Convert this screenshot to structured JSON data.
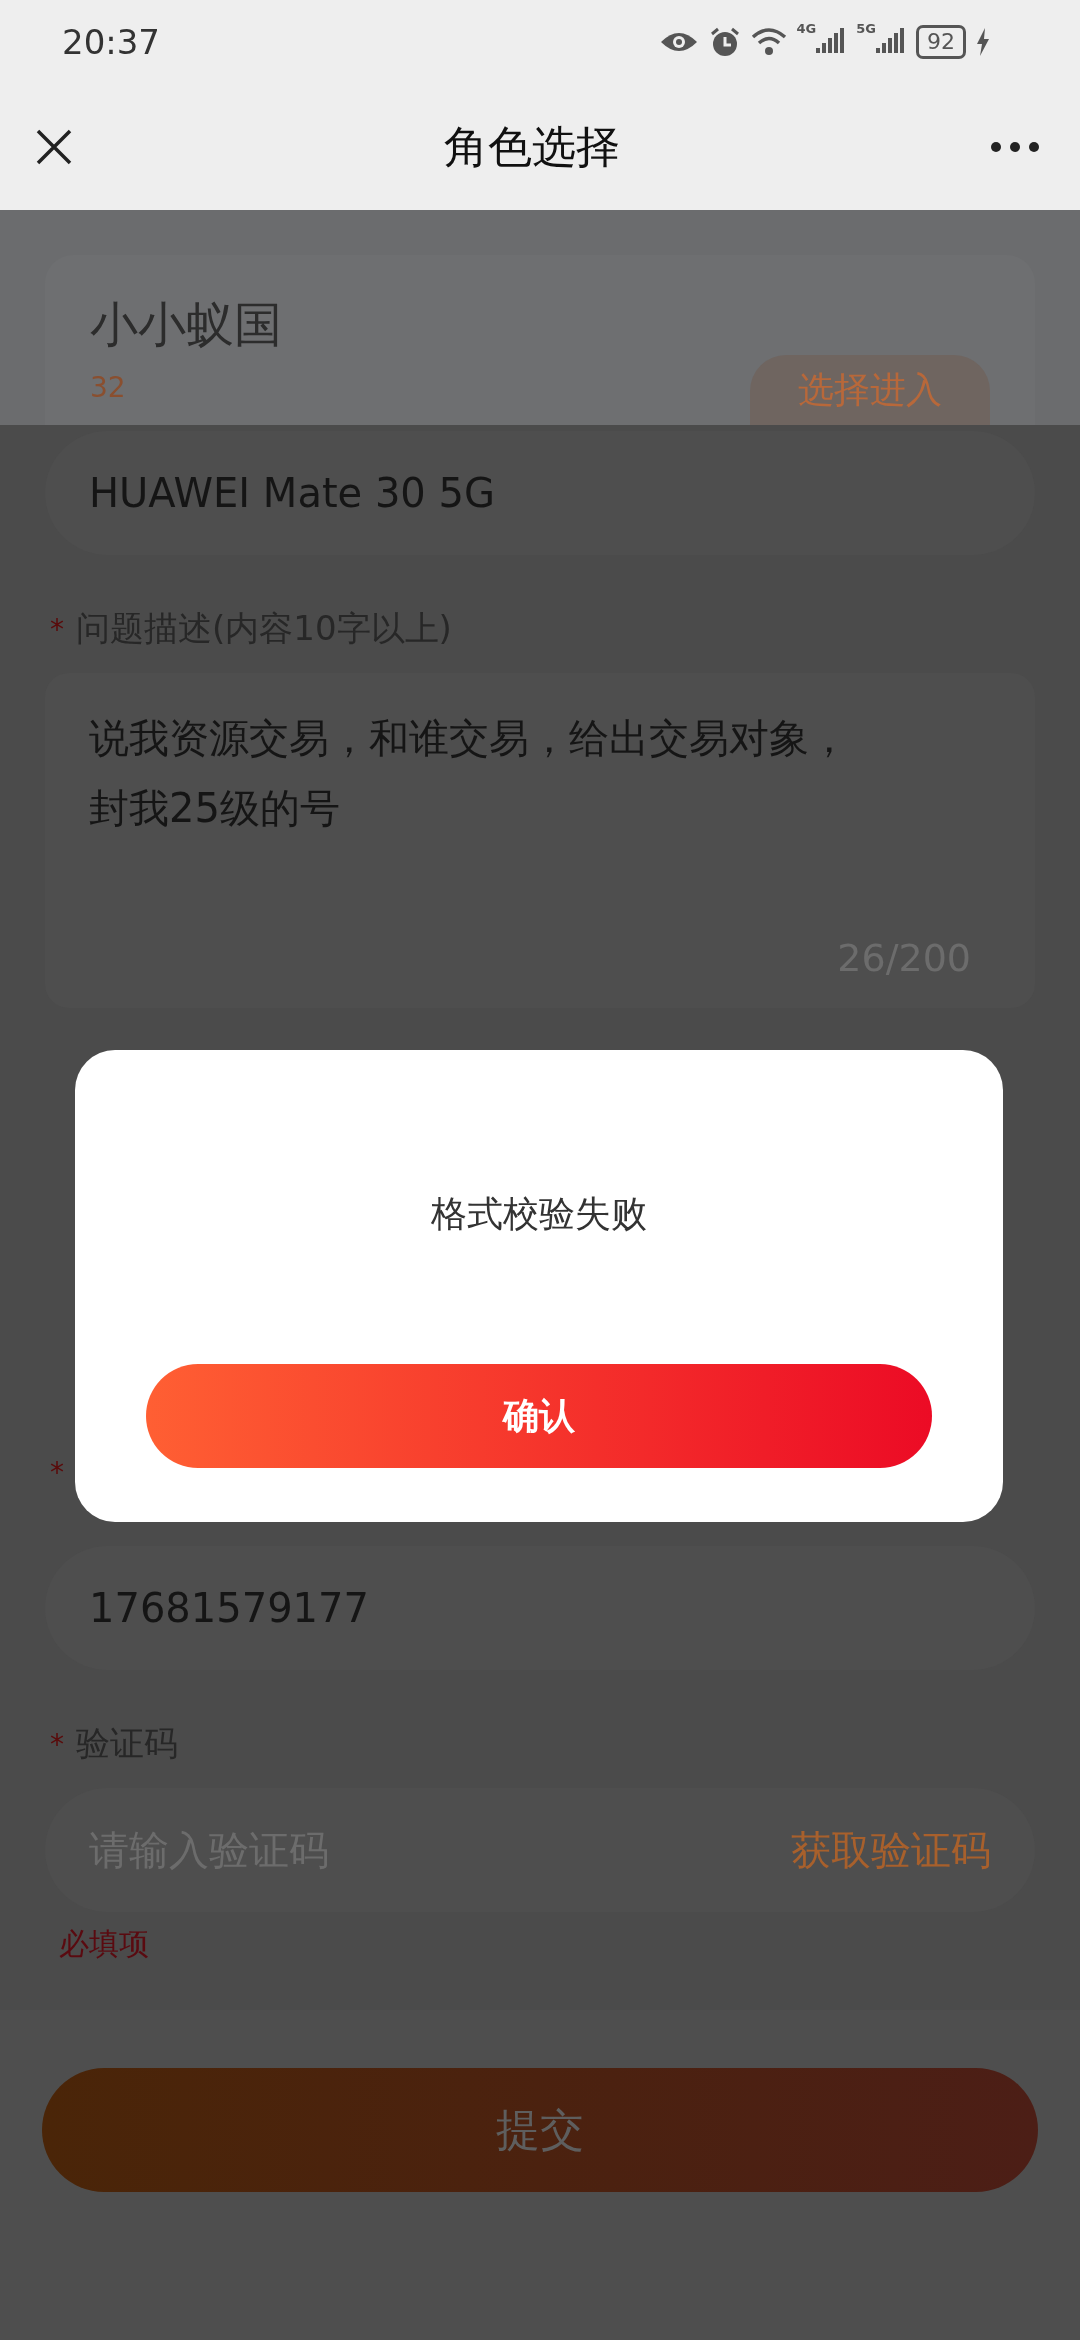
{
  "status_bar": {
    "time": "20:37",
    "networks": [
      "4G",
      "5G"
    ],
    "battery": "92"
  },
  "nav": {
    "title": "角色选择"
  },
  "role": {
    "name": "小小蚁国",
    "subtitle": "32",
    "button": "选择进入"
  },
  "fields": [
    {
      "kind": "input",
      "value": "HUAWEI Mate 30 5G"
    },
    {
      "kind": "textarea",
      "mark": "*",
      "label": "问题描述(内容10字以上)",
      "lines": [
        "说我资源交易，和谁交易，给出交易对象，",
        "封我25级的号"
      ],
      "counter": "26/200"
    },
    {
      "kind": "hidden",
      "mark": "*"
    },
    {
      "kind": "input",
      "value": "17681579177"
    },
    {
      "kind": "code",
      "mark": "*",
      "label": "验证码",
      "placeholder": "请输入验证码",
      "action": "获取验证码",
      "error": "必填项"
    }
  ],
  "submit": {
    "label": "提交"
  },
  "dialog": {
    "message": "格式校验失败",
    "button": "确认"
  }
}
